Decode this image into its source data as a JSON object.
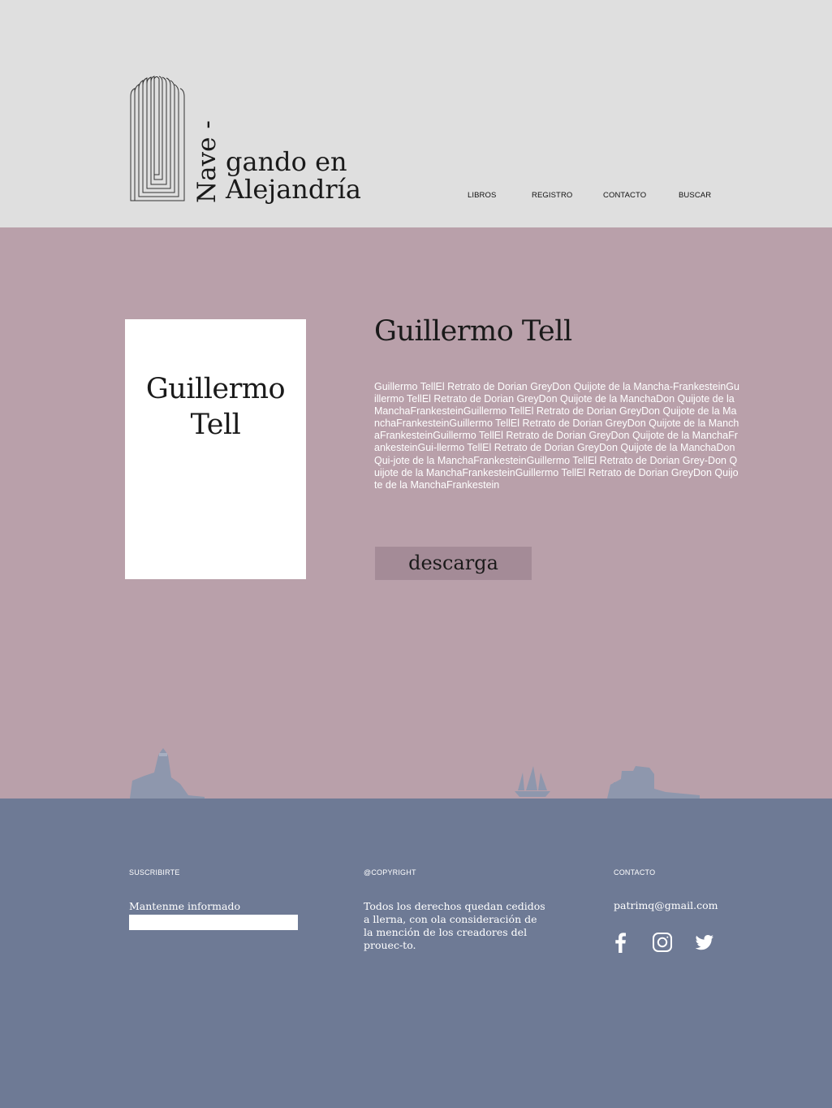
{
  "header": {
    "logo": {
      "vertical_text": "Nave -",
      "line1": "gando en",
      "line2": "Alejandría"
    },
    "nav": [
      {
        "label": "LIBROS"
      },
      {
        "label": "REGISTRO"
      },
      {
        "label": "CONTACTO"
      },
      {
        "label": "BUSCAR"
      }
    ]
  },
  "book": {
    "cover_line1": "Guillermo",
    "cover_line2": "Tell",
    "title": "Guillermo Tell",
    "description": "Guillermo TellEl Retrato de Dorian GreyDon Quijote de la Mancha-FrankesteinGuillermo TellEl Retrato de Dorian GreyDon Quijote de la ManchaDon Quijote de la ManchaFrankesteinGuillermo TellEl Retrato de Dorian GreyDon Quijote de la ManchaFrankesteinGuillermo TellEl Retrato de Dorian GreyDon Quijote de la ManchaFrankesteinGuillermo TellEl Retrato de Dorian GreyDon Quijote de la ManchaFrankesteinGui-llermo TellEl Retrato de Dorian GreyDon Quijote de la ManchaDon Qui-jote de la ManchaFrankesteinGuillermo TellEl Retrato de Dorian Grey-Don Quijote de la ManchaFrankesteinGuillermo TellEl Retrato de Dorian GreyDon Quijote de la ManchaFrankestein",
    "download_label": "descarga"
  },
  "footer": {
    "subscribe": {
      "heading": "SUSCRIBIRTE",
      "label": "Mantenme informado",
      "input_value": ""
    },
    "copyright": {
      "heading": "@COPYRIGHT",
      "text": "Todos los derechos quedan cedidos a llerna, con ola consideración de la mención de los creadores del prouec-to."
    },
    "contact": {
      "heading": "CONTACTO",
      "email": "patrimq@gmail.com",
      "social_icons": [
        "facebook-icon",
        "instagram-icon",
        "twitter-icon"
      ]
    }
  },
  "colors": {
    "header_bg": "#dfdfdf",
    "main_bg": "#b9a0aa",
    "footer_bg": "#6e7a95",
    "button_bg": "#a48b97",
    "silhouette": "#8e97ad"
  }
}
